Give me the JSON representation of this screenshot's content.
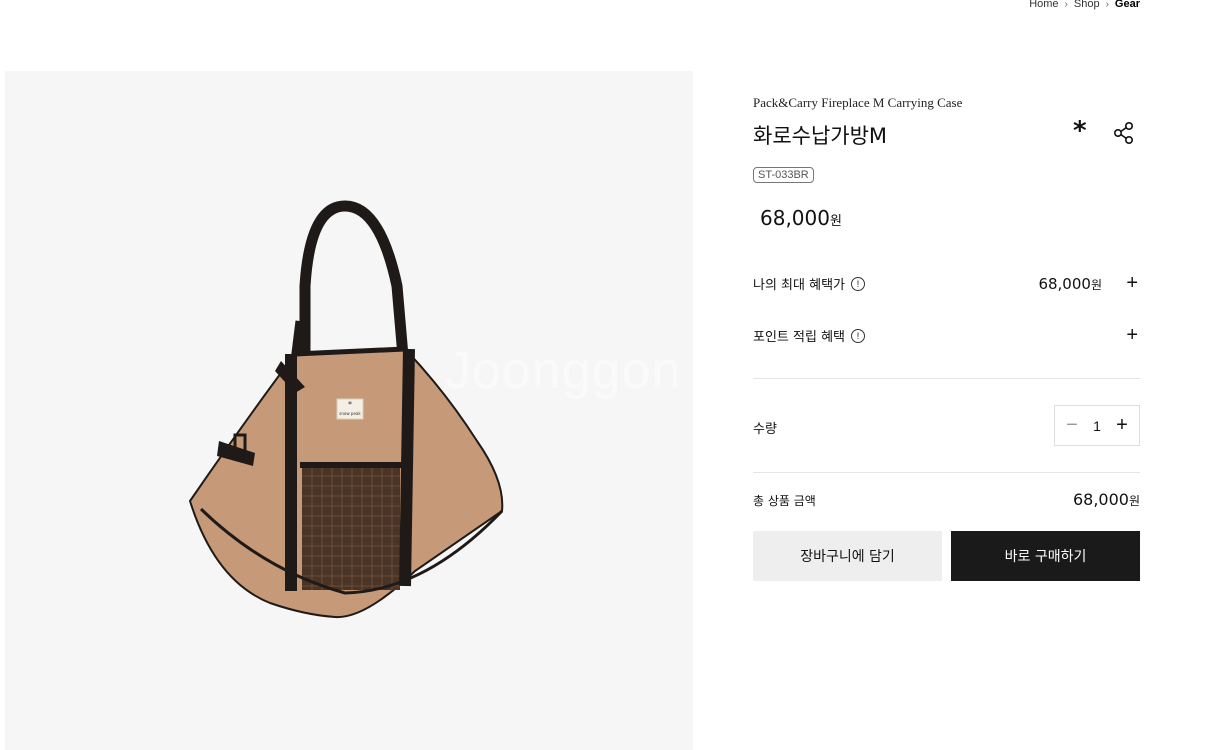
{
  "breadcrumb": {
    "items": [
      "Home",
      "Shop"
    ],
    "current": "Gear",
    "separator": "›"
  },
  "watermark": "Joonggon",
  "product": {
    "subtitle": "Pack&Carry Fireplace M Carrying Case",
    "title": "화로수납가방M",
    "code": "ST-033BR",
    "price": "68,000",
    "currency": "원",
    "wish_symbol": "*",
    "icons": {
      "wish": "asterisk-icon",
      "share": "share-icon",
      "info": "info-icon"
    },
    "tag_text": "snow peak"
  },
  "benefits": {
    "max_label": "나의 최대 혜택가",
    "max_price": "68,000",
    "points_label": "포인트 적립 혜택",
    "info_glyph": "!",
    "expand_glyph": "+"
  },
  "quantity": {
    "label": "수량",
    "value": "1",
    "dec": "−",
    "inc": "+"
  },
  "total": {
    "label": "총 상품 금액",
    "amount": "68,000",
    "currency": "원"
  },
  "actions": {
    "cart": "장바구니에 담기",
    "buy": "바로 구매하기"
  },
  "colors": {
    "bag_body": "#c69a78",
    "strap": "#1f1a17",
    "panel_bg": "#f6f6f6",
    "buy_bg": "#1a1a1a",
    "cart_bg": "#eeeeee"
  }
}
